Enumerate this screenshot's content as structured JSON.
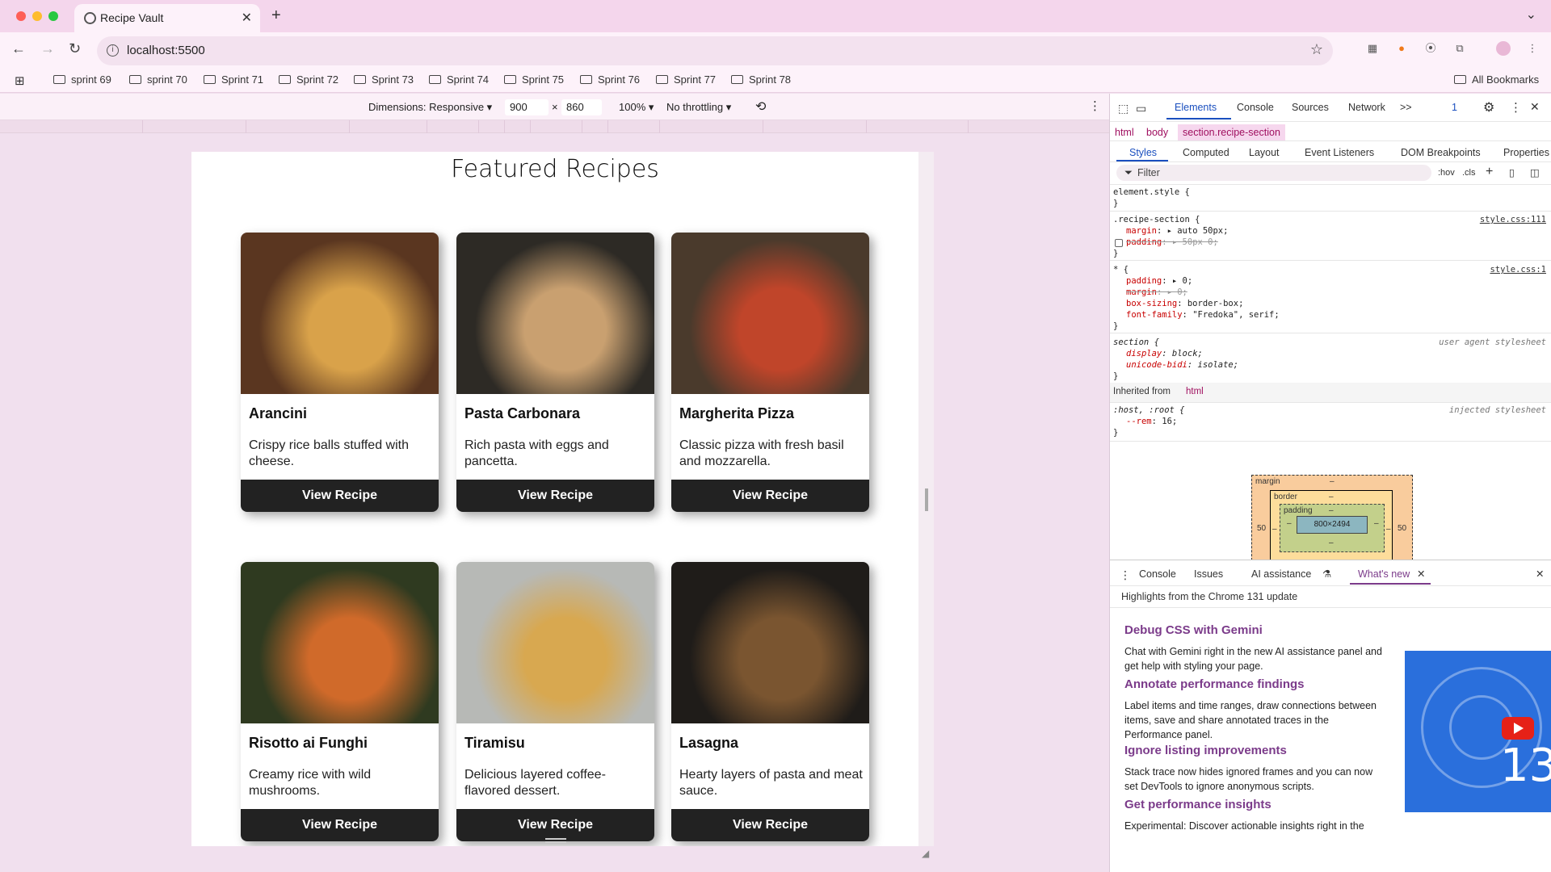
{
  "browser": {
    "tab_title": "Recipe Vault",
    "url": "localhost:5500",
    "bookmarks": [
      "sprint 69",
      "sprint 70",
      "Sprint 71",
      "Sprint 72",
      "Sprint 73",
      "Sprint 74",
      "Sprint 75",
      "Sprint 76",
      "Sprint 77",
      "Sprint 78"
    ],
    "all_bookmarks": "All Bookmarks"
  },
  "device_toolbar": {
    "dimensions_label": "Dimensions: Responsive ▾",
    "width": "900",
    "times": "×",
    "height": "860",
    "zoom": "100% ▾",
    "throttling": "No throttling ▾"
  },
  "page": {
    "title": "Featured Recipes",
    "recipes": [
      {
        "name": "Arancini",
        "description": "Crispy rice balls stuffed with cheese.",
        "button": "View Recipe",
        "image_colors": [
          "#5a3620",
          "#d9a24a"
        ]
      },
      {
        "name": "Pasta Carbonara",
        "description": "Rich pasta with eggs and pancetta.",
        "button": "View Recipe",
        "image_colors": [
          "#2d2a25",
          "#c9a070"
        ]
      },
      {
        "name": "Margherita Pizza",
        "description": "Classic pizza with fresh basil and mozzarella.",
        "button": "View Recipe",
        "image_colors": [
          "#4a3a2c",
          "#c0452a"
        ]
      },
      {
        "name": "Risotto ai Funghi",
        "description": "Creamy rice with wild mushrooms.",
        "button": "View Recipe",
        "image_colors": [
          "#2f3a20",
          "#d06a2a"
        ]
      },
      {
        "name": "Tiramisu",
        "description": "Delicious layered coffee-flavored dessert.",
        "button": "View Recipe",
        "image_colors": [
          "#b7b9b6",
          "#d8a850"
        ]
      },
      {
        "name": "Lasagna",
        "description": "Hearty layers of pasta and meat sauce.",
        "button": "View Recipe",
        "image_colors": [
          "#1f1c19",
          "#7a5530"
        ]
      }
    ]
  },
  "devtools": {
    "tabs": [
      "Elements",
      "Console",
      "Sources",
      "Network"
    ],
    "more": ">>",
    "issues_badge": "1",
    "breadcrumb": [
      "html",
      "body",
      "section.recipe-section"
    ],
    "subtabs": [
      "Styles",
      "Computed",
      "Layout",
      "Event Listeners",
      "DOM Breakpoints",
      "Properties"
    ],
    "filter_placeholder": "Filter",
    "hov": ":hov",
    "cls": ".cls",
    "styles": {
      "element_style": "element.style {",
      "close": "}",
      "rule1_selector": ".recipe-section {",
      "rule1_src": "style.css:111",
      "rule1_p1_name": "margin",
      "rule1_p1_val": ": ▸ auto 50px;",
      "rule1_p2_name": "padding",
      "rule1_p2_val": ": ▸ 50px 0;",
      "rule2_selector": "* {",
      "rule2_src": "style.css:1",
      "rule2_p1_name": "padding",
      "rule2_p1_val": ": ▸ 0;",
      "rule2_p2_name": "margin",
      "rule2_p2_val": ": ▸ 0;",
      "rule2_p3_name": "box-sizing",
      "rule2_p3_val": ": border-box;",
      "rule2_p4_name": "font-family",
      "rule2_p4_val": ": \"Fredoka\", serif;",
      "rule3_selector": "section {",
      "rule3_src": "user agent stylesheet",
      "rule3_p1_name": "display",
      "rule3_p1_val": ": block;",
      "rule3_p2_name": "unicode-bidi",
      "rule3_p2_val": ": isolate;",
      "inherited_label": "Inherited from",
      "inherited_tag": "html",
      "rule4_selector": ":host, :root {",
      "rule4_src": "injected stylesheet",
      "rule4_p1_name": "--rem",
      "rule4_p1_val": ": 16;"
    },
    "box_model": {
      "margin_label": "margin",
      "border_label": "border",
      "padding_label": "padding",
      "dash": "–",
      "content": "800×2494",
      "margin_left": "50",
      "margin_right": "50"
    },
    "drawer": {
      "tabs": [
        "Console",
        "Issues",
        "AI assistance",
        "What's new"
      ],
      "highlight": "Highlights from the Chrome 131 update",
      "items": [
        {
          "heading": "Debug CSS with Gemini",
          "body": "Chat with Gemini right in the new AI assistance panel and get help with styling your page."
        },
        {
          "heading": "Annotate performance findings",
          "body": "Label items and time ranges, draw connections between items, save and share annotated traces in the Performance panel."
        },
        {
          "heading": "Ignore listing improvements",
          "body": "Stack trace now hides ignored frames and you can now set DevTools to ignore anonymous scripts."
        },
        {
          "heading": "Get performance insights",
          "body": "Experimental: Discover actionable insights right in the"
        }
      ],
      "video_number": "13"
    }
  }
}
